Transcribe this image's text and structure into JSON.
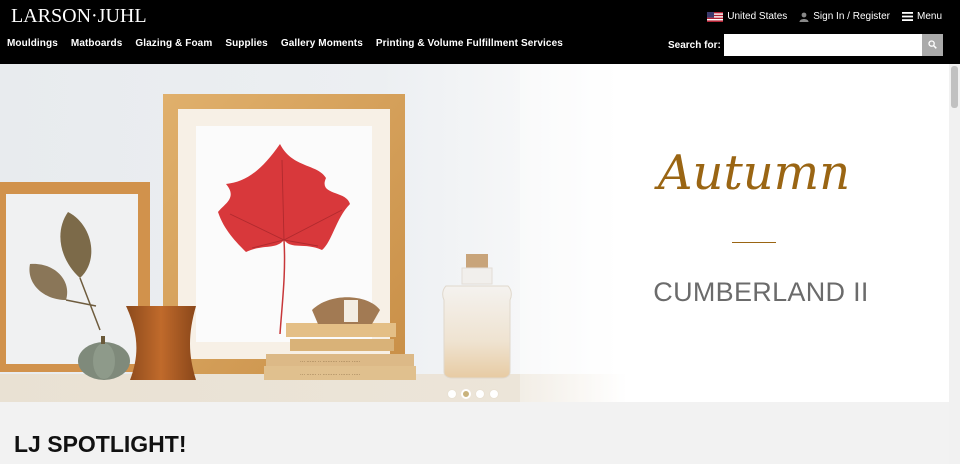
{
  "header": {
    "logo_text": "LARSON·JUHL",
    "region": "United States",
    "account": "Sign In / Register",
    "menu": "Menu",
    "nav": [
      "Mouldings",
      "Matboards",
      "Glazing & Foam",
      "Supplies",
      "Gallery Moments",
      "Printing & Volume Fulfillment Services"
    ],
    "search_label": "Search for:",
    "search_value": ""
  },
  "hero": {
    "title": "Autumn",
    "subtitle": "CUMBERLAND II",
    "slides": 4,
    "active_slide": 2,
    "accent_color": "#9a6513"
  },
  "section": {
    "title": "LJ SPOTLIGHT!"
  },
  "icons": {
    "region": "us-flag-icon",
    "account": "user-icon",
    "menu": "hamburger-icon",
    "search": "magnifier-icon"
  }
}
